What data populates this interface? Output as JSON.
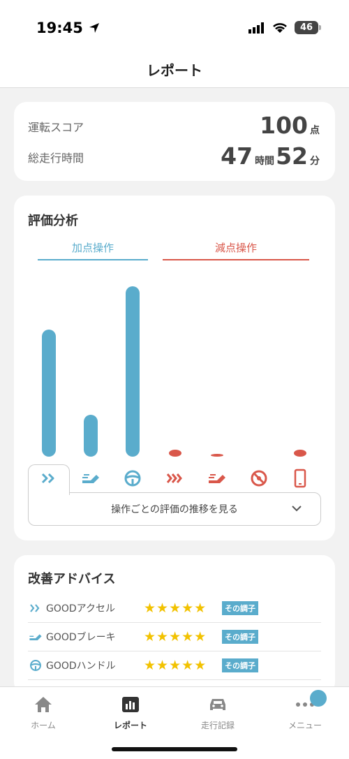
{
  "status_bar": {
    "time": "19:45",
    "battery": "46"
  },
  "header": {
    "title": "レポート"
  },
  "summary": {
    "score_label": "運転スコア",
    "score_value": "100",
    "score_unit": "点",
    "time_label": "総走行時間",
    "hours_value": "47",
    "hours_unit": "時間",
    "minutes_value": "52",
    "minutes_unit": "分"
  },
  "analysis": {
    "title": "評価分析",
    "plus_group": "加点操作",
    "minus_group": "減点操作",
    "trend_label": "操作ごとの評価の推移を見る"
  },
  "chart_data": {
    "type": "bar",
    "categories": [
      "アクセル",
      "ブレーキ",
      "ハンドル",
      "急アクセル",
      "急ブレーキ",
      "急ハンドル",
      "スマホ"
    ],
    "series": [
      {
        "name": "加点操作",
        "values": [
          0.7,
          0.23,
          0.94,
          0,
          0,
          0,
          0
        ]
      },
      {
        "name": "減点操作",
        "values": [
          0,
          0,
          0,
          0.04,
          0.015,
          0,
          0.04
        ]
      }
    ],
    "colors": {
      "plus": "#5aaccc",
      "minus": "#d9574a"
    }
  },
  "advice": {
    "title": "改善アドバイス",
    "items": [
      {
        "label": "GOODアクセル",
        "stars": "★★★★★",
        "badge": "その調子",
        "icon": "accelerator-icon"
      },
      {
        "label": "GOODブレーキ",
        "stars": "★★★★★",
        "badge": "その調子",
        "icon": "brake-icon"
      },
      {
        "label": "GOODハンドル",
        "stars": "★★★★★",
        "badge": "その調子",
        "icon": "steering-wheel-icon"
      }
    ]
  },
  "nav": {
    "items": [
      {
        "label": "ホーム",
        "icon": "home-icon"
      },
      {
        "label": "レポート",
        "icon": "chart-icon",
        "active": true
      },
      {
        "label": "走行記録",
        "icon": "car-icon"
      },
      {
        "label": "メニュー",
        "icon": "menu-dots-icon"
      }
    ]
  }
}
